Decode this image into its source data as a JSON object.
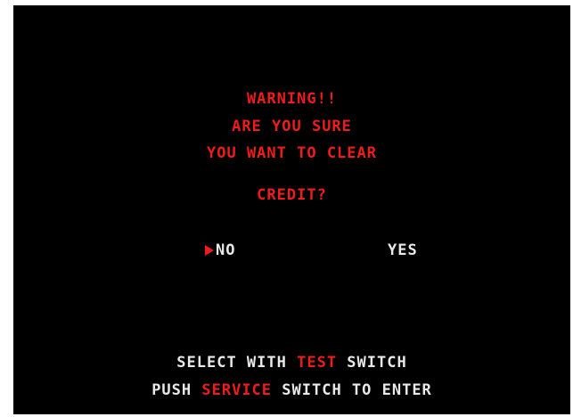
{
  "dialog": {
    "line1": "WARNING!!",
    "line2": "ARE YOU SURE",
    "line3": "YOU WANT TO CLEAR",
    "line4": "CREDIT?"
  },
  "options": {
    "no_label": "NO",
    "yes_label": "YES",
    "selected": "NO"
  },
  "instructions": {
    "row1_a": "SELECT WITH ",
    "row1_b": "TEST",
    "row1_c": " SWITCH",
    "row2_a": "PUSH ",
    "row2_b": "SERVICE",
    "row2_c": " SWITCH TO ENTER"
  },
  "colors": {
    "background": "#000000",
    "accent_red": "#ee1c1c",
    "text_white": "#e9e9e9"
  },
  "icons": {
    "cursor": "triangle-right-icon"
  }
}
